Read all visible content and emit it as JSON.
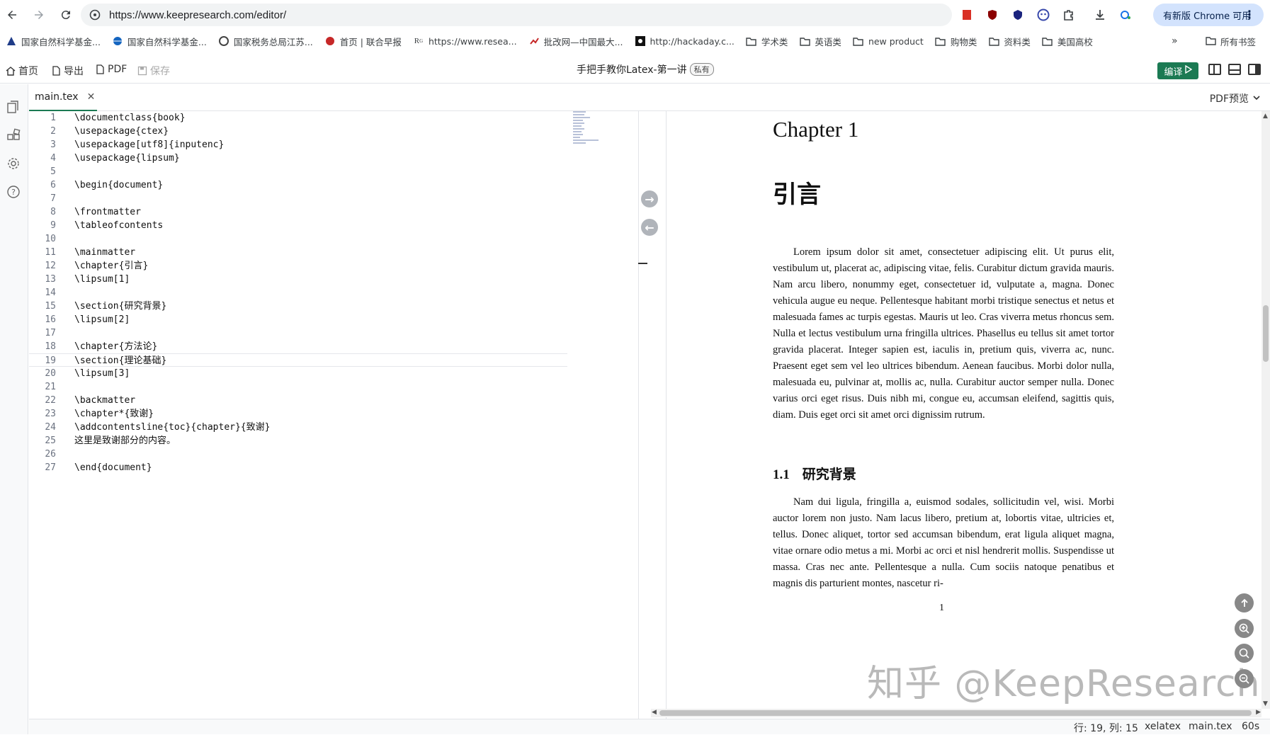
{
  "browser": {
    "url": "https://www.keepresearch.com/editor/",
    "update_label": "有新版 Chrome 可用",
    "bookmarks": [
      {
        "label": "国家自然科学基金...",
        "icon": "nsfc-logo-icon"
      },
      {
        "label": "国家自然科学基金...",
        "icon": "globe-logo-icon"
      },
      {
        "label": "国家税务总局江苏...",
        "icon": "tax-logo-icon"
      },
      {
        "label": "首页 | 联合早报",
        "icon": "zaobao-logo-icon"
      },
      {
        "label": "https://www.resea...",
        "icon": "researchgate-icon"
      },
      {
        "label": "批改网—中国最大...",
        "icon": "pigai-logo-icon"
      },
      {
        "label": "http://hackaday.c...",
        "icon": "hackaday-logo-icon"
      },
      {
        "label": "学术类",
        "icon": "folder-icon"
      },
      {
        "label": "英语类",
        "icon": "folder-icon"
      },
      {
        "label": "new product",
        "icon": "folder-icon"
      },
      {
        "label": "购物类",
        "icon": "folder-icon"
      },
      {
        "label": "资料类",
        "icon": "folder-icon"
      },
      {
        "label": "美国高校",
        "icon": "folder-icon"
      }
    ],
    "more_label": "»",
    "all_bookmarks_label": "所有书签"
  },
  "app": {
    "home_label": "首页",
    "export_label": "导出",
    "pdf_label": "PDF",
    "save_label": "保存",
    "doc_title": "手把手教你Latex-第一讲",
    "private_label": "私有",
    "compile_label": "编译",
    "file_tab": "main.tex",
    "pdf_preview_label": "PDF预览"
  },
  "code_lines": [
    "\\documentclass{book}",
    "\\usepackage{ctex}",
    "\\usepackage[utf8]{inputenc}",
    "\\usepackage{lipsum}",
    "",
    "\\begin{document}",
    "",
    "\\frontmatter",
    "\\tableofcontents",
    "",
    "\\mainmatter",
    "\\chapter{引言}",
    "\\lipsum[1]",
    "",
    "\\section{研究背景}",
    "\\lipsum[2]",
    "",
    "\\chapter{方法论}",
    "\\section{理论基础}",
    "\\lipsum[3]",
    "",
    "\\backmatter",
    "\\chapter*{致谢}",
    "\\addcontentsline{toc}{chapter}{致谢}",
    "这里是致谢部分的内容。",
    "",
    "\\end{document}"
  ],
  "pdf": {
    "chapter_heading": "Chapter 1",
    "chapter_title": "引言",
    "para1": "Lorem ipsum dolor sit amet, consectetuer adipiscing elit. Ut purus elit, vestibulum ut, placerat ac, adipiscing vitae, felis. Curabitur dictum gravida mauris. Nam arcu libero, nonummy eget, consectetuer id, vulputate a, magna. Donec vehicula augue eu neque. Pellentesque habitant morbi tristique senectus et netus et malesuada fames ac turpis egestas. Mauris ut leo. Cras viverra metus rhoncus sem. Nulla et lectus vestibulum urna fringilla ultrices. Phasellus eu tellus sit amet tortor gravida placerat. Integer sapien est, iaculis in, pretium quis, viverra ac, nunc. Praesent eget sem vel leo ultrices bibendum. Aenean faucibus. Morbi dolor nulla, malesuada eu, pulvinar at, mollis ac, nulla. Curabitur auctor semper nulla. Donec varius orci eget risus. Duis nibh mi, congue eu, accumsan eleifend, sagittis quis, diam. Duis eget orci sit amet orci dignissim rutrum.",
    "section_number": "1.1",
    "section_title": "研究背景",
    "para2": "Nam dui ligula, fringilla a, euismod sodales, sollicitudin vel, wisi. Morbi auctor lorem non justo. Nam lacus libero, pretium at, lobortis vitae, ultricies et, tellus. Donec aliquet, tortor sed accumsan bibendum, erat ligula aliquet magna, vitae ornare odio metus a mi. Morbi ac orci et nisl hendrerit mollis. Suspendisse ut massa. Cras nec ante. Pellentesque a nulla. Cum sociis natoque penatibus et magnis dis parturient montes, nascetur ri-",
    "page_number": "1",
    "watermark": "知乎 @KeepResearch"
  },
  "status": {
    "position": "行: 19, 列: 15",
    "engine": "xelatex",
    "file": "main.tex",
    "timer": "60s"
  },
  "colors": {
    "compile_green": "#1b7a53",
    "update_pill": "#d3e3fd"
  }
}
